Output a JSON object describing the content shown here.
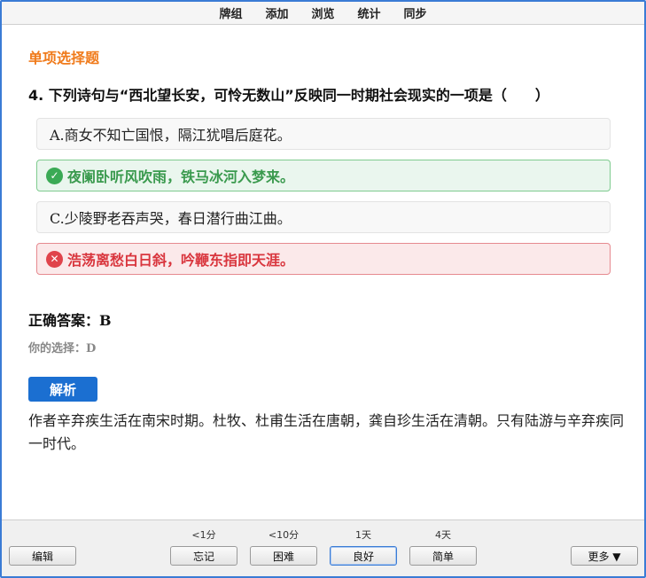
{
  "topbar": {
    "menu": [
      "牌组",
      "添加",
      "浏览",
      "统计",
      "同步"
    ]
  },
  "card": {
    "section_title": "单项选择题",
    "question": "4. 下列诗句与“西北望长安，可怜无数山”反映同一时期社会现实的一项是（　　）",
    "options": [
      {
        "text": "A.商女不知亡国恨，隔江犹唱后庭花。",
        "state": "neutral"
      },
      {
        "text": "夜阑卧听风吹雨，铁马冰河入梦来。",
        "state": "correct",
        "icon": "check-icon"
      },
      {
        "text": "C.少陵野老吞声哭，春日潜行曲江曲。",
        "state": "neutral"
      },
      {
        "text": "浩荡离愁白日斜，吟鞭东指即天涯。",
        "state": "wrong",
        "icon": "cross-icon"
      }
    ],
    "correct_label": "正确答案：",
    "correct_value": "B",
    "your_choice_label": "你的选择：",
    "your_choice_value": "D",
    "analysis_label": "解析",
    "analysis_text": "作者辛弃疾生活在南宋时期。杜牧、杜甫生活在唐朝，龚自珍生活在清朝。只有陆游与辛弃疾同一时代。"
  },
  "bottombar": {
    "edit_label": "编辑",
    "more_label": "更多 ▼",
    "answers": [
      {
        "interval": "<1分",
        "label": "忘记"
      },
      {
        "interval": "<10分",
        "label": "困难"
      },
      {
        "interval": "1天",
        "label": "良好"
      },
      {
        "interval": "4天",
        "label": "简单"
      }
    ]
  },
  "colors": {
    "accent": "#1b6fd1",
    "section_title": "#f07a1a",
    "correct": "#3aaa55",
    "wrong": "#e0434b"
  }
}
